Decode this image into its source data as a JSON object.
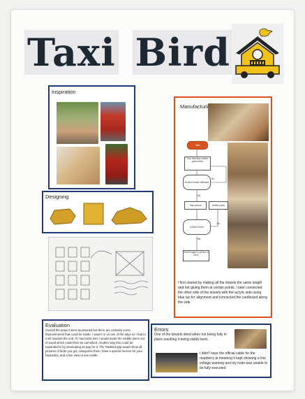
{
  "poster": {
    "title_word1": "Taxi",
    "title_word2": "Bird"
  },
  "sections": {
    "inspiration": "Inspiration",
    "designing": "Designing",
    "manufacturing": "Manufacturing",
    "evaluation": "Evaluation",
    "errors": "Errors"
  },
  "manufacturing_text": "I first started by making all the dowels the same length and hot giuing them at certain points. I later connected the other side of the dowels with the acrylic side using blue tac for alignment and connected the cardboard along the side",
  "evaluation_text": "Overall the project went as planned but there are certainly some improvements that could be made. I wasn't in on one of the days so I had to rush towards the end. If I had extra time I would made the middle piece out of wood which could then be varnished. Another way this could be expanded is by developing an app for it. The TaxiBird app would show all pictures of birds you got, categorise them, have a special section for your favourites, and a live view to see inside.",
  "errors": {
    "text1": "One of the dowels dried when not being fully in place resulting it being visibly bent.",
    "text2": "I didn't have the official cable for the raspberry pi meaning it kept showing a low voltage warning and my code was unable to be fully executed"
  },
  "flowchart": {
    "start": "Start",
    "step1": "Turn detection sensor python files",
    "decision1": "Is there motion detected",
    "yes1": "Yes",
    "no1": "No",
    "take_picture": "Take picture",
    "delete_picture": "Delete photo",
    "decision2": "Is there a bird",
    "yes2": "Yes",
    "no2": "No",
    "send": "Send images to phone or drive"
  },
  "colors": {
    "title": "#1e2833",
    "panel_border": "#1d3a74",
    "accent_orange": "#d9531e",
    "taxi_yellow": "#f2c21b"
  },
  "icons": [
    "bird-icon",
    "taxi-house-icon"
  ]
}
